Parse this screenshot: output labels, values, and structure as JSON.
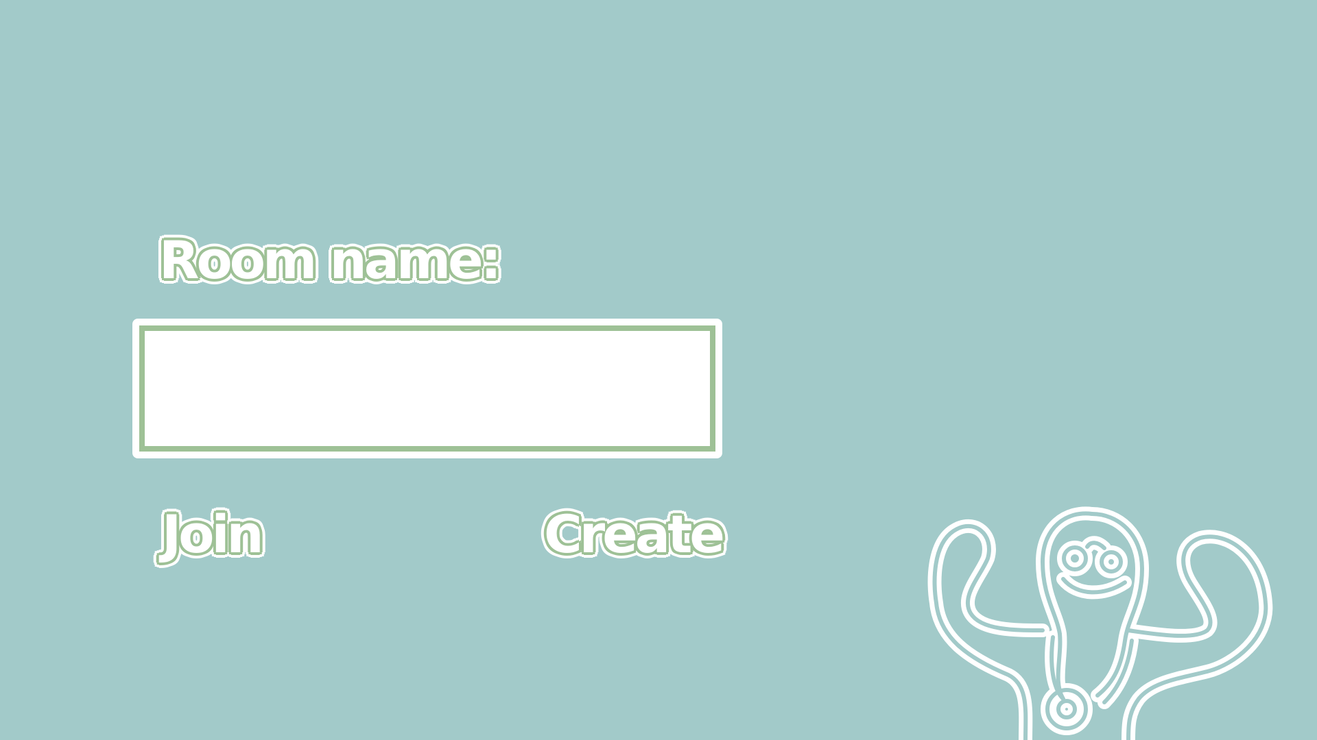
{
  "form": {
    "room_label": "Room name:",
    "room_input_value": "",
    "room_input_placeholder": ""
  },
  "buttons": {
    "join_label": "Join",
    "create_label": "Create"
  },
  "mascot": {
    "icon": "monster-outline-icon"
  },
  "colors": {
    "background": "#a2cac9",
    "accent_green": "#9ec196",
    "white": "#ffffff"
  }
}
